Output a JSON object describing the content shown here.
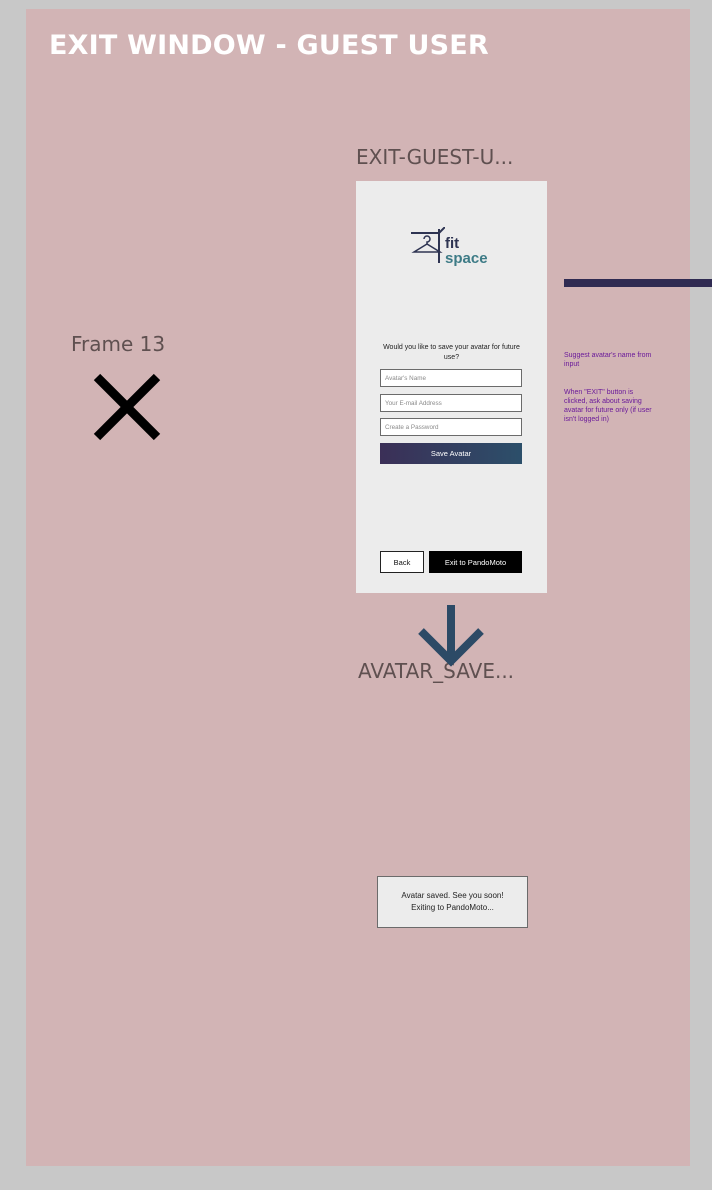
{
  "board": {
    "title": "EXIT WINDOW - GUEST USER"
  },
  "frames": {
    "frame13_label": "Frame 13",
    "exit_frame_label": "EXIT-GUEST-U...",
    "avatar_frame_label": "AVATAR_SAVE..."
  },
  "logo": {
    "word1": "fit",
    "word2": "space"
  },
  "dialog": {
    "question": "Would you like to save your avatar for future use?",
    "name_placeholder": "Avatar's Name",
    "email_placeholder": "Your E-mail Address",
    "password_placeholder": "Create a Password",
    "save_label": "Save Avatar",
    "back_label": "Back",
    "exit_label": "Exit to PandoMoto"
  },
  "notes": {
    "note1": "Suggest avatar's name from input",
    "note2": "When \"EXIT\" button is clicked, ask about saving avatar for future only (if user isn't logged in)"
  },
  "toast": {
    "line1": "Avatar saved. See you soon!",
    "line2": "Exiting to PandoMoto..."
  },
  "icons": {
    "close": "close-x-icon",
    "arrow": "arrow-down-icon",
    "hanger": "hanger-icon"
  },
  "colors": {
    "board_bg": "#d2b4b5",
    "accent_dark": "#302b52",
    "logo_teal": "#3d7b86",
    "note_text": "#6a1a9a"
  }
}
